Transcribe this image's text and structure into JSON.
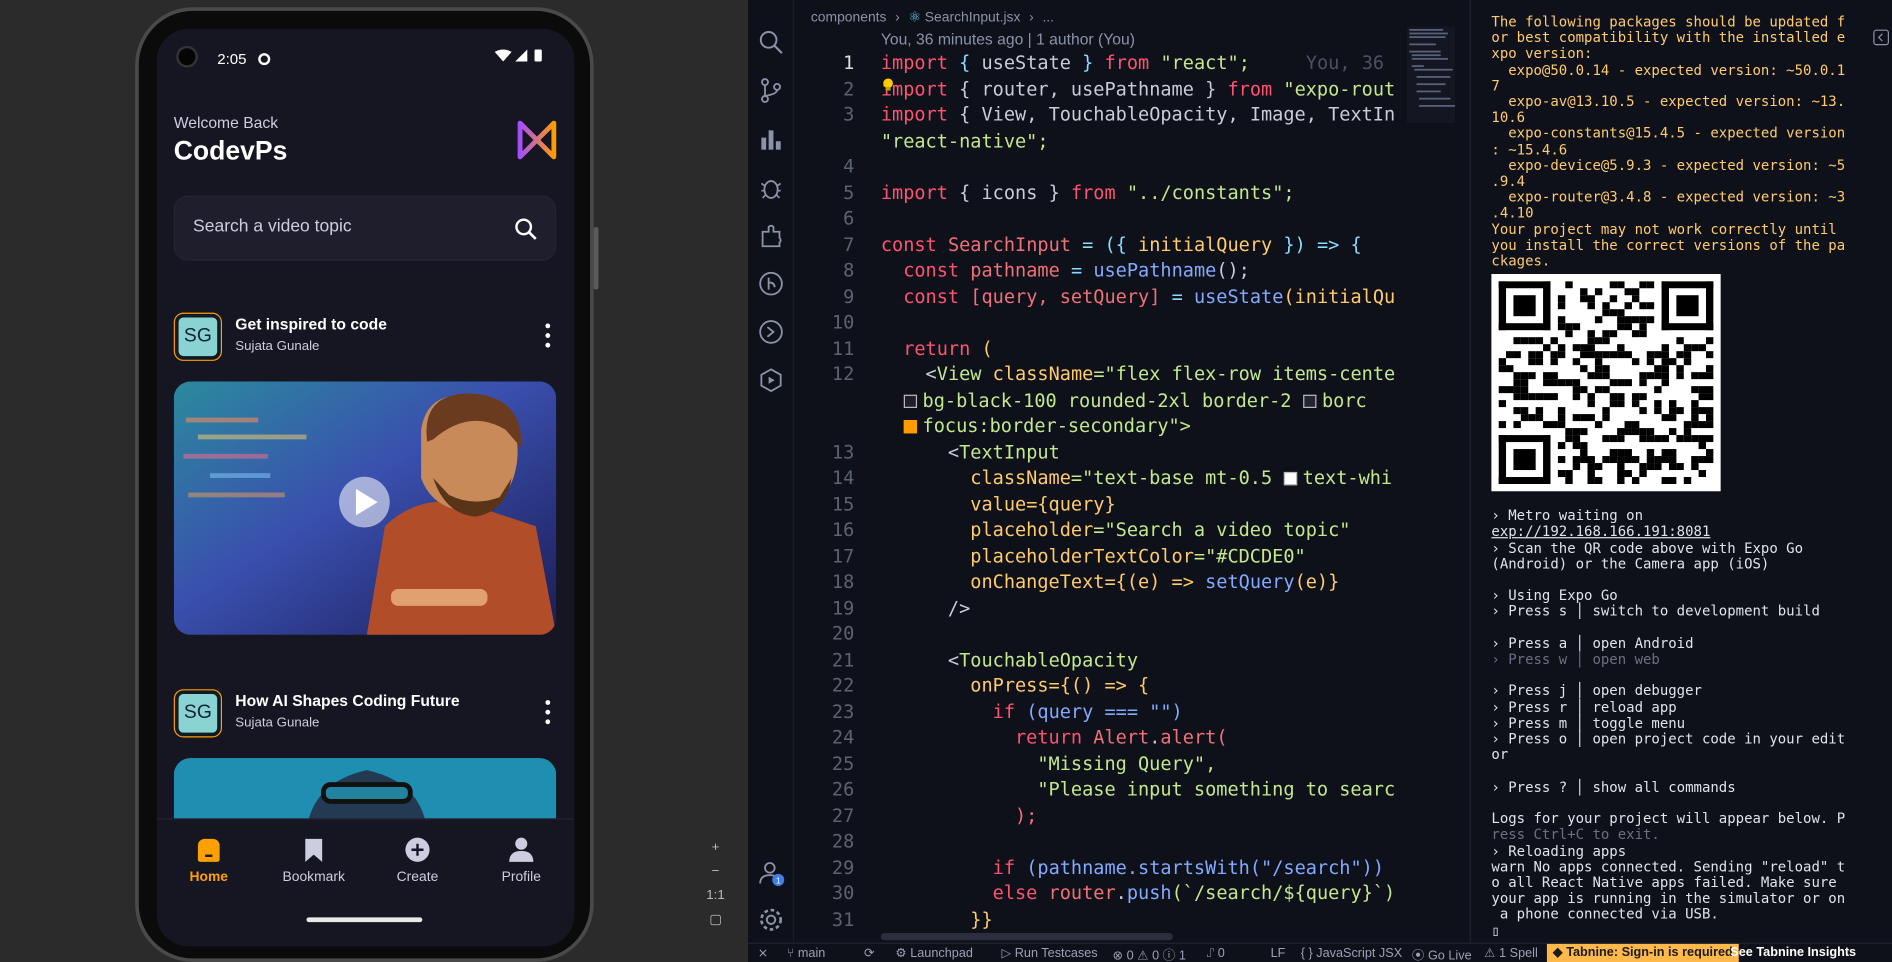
{
  "emulator": {
    "status_time": "2:05",
    "welcome_label": "Welcome Back",
    "username": "CodevPs",
    "search_placeholder": "Search a video topic",
    "posts": [
      {
        "title": "Get inspired to code",
        "author": "Sujata Gunale",
        "avatar": "SG"
      },
      {
        "title": "How AI Shapes Coding Future",
        "author": "Sujata Gunale",
        "avatar": "SG"
      }
    ],
    "tabs": [
      {
        "label": "Home",
        "icon": "home-icon",
        "active": true
      },
      {
        "label": "Bookmark",
        "icon": "bookmark-icon",
        "active": false
      },
      {
        "label": "Create",
        "icon": "plus-circle-icon",
        "active": false
      },
      {
        "label": "Profile",
        "icon": "profile-icon",
        "active": false
      }
    ],
    "tools": [
      "+",
      "−",
      "1:1",
      "▢"
    ],
    "accent": "#FF9C01"
  },
  "editor": {
    "breadcrumbs": [
      "components",
      "SearchInput.jsx",
      "..."
    ],
    "blame": "You, 36 minutes ago | 1 author (You)",
    "inline_blame": "You, 36",
    "accounts_badge": "1",
    "line_numbers": [
      "1",
      "2",
      "3",
      "",
      "4",
      "5",
      "6",
      "7",
      "8",
      "9",
      "10",
      "11",
      "12",
      "",
      "",
      "13",
      "14",
      "15",
      "16",
      "17",
      "18",
      "19",
      "20",
      "21",
      "22",
      "23",
      "24",
      "25",
      "26",
      "27",
      "28",
      "29",
      "30",
      "31"
    ],
    "code": {
      "l1_a": "import",
      "l1_b": " { ",
      "l1_c": "useState",
      "l1_d": " } ",
      "l1_e": "from",
      "l1_f": " \"react\";",
      "l2_a": "import",
      "l2_b": " { router, usePathname } ",
      "l2_c": "from",
      "l2_d": " \"expo-rout",
      "l3_a": "import",
      "l3_b": " { View, TouchableOpacity, Image, TextIn",
      "l3w": "\"react-native\";",
      "l5_a": "import",
      "l5_b": " { icons } ",
      "l5_c": "from",
      "l5_d": " \"../constants\";",
      "l7_a": "const ",
      "l7_b": "SearchInput",
      "l7_c": " = ({ ",
      "l7_d": "initialQuery",
      "l7_e": " }) => {",
      "l8_a": "  const ",
      "l8_b": "pathname",
      "l8_c": " = ",
      "l8_d": "usePathname",
      "l8_e": "();",
      "l9_a": "  const ",
      "l9_b": "[query, setQuery]",
      "l9_c": " = ",
      "l9_d": "useState",
      "l9_e": "(initialQu",
      "l11_a": "  return",
      "l11_b": " (",
      "l12_a": "    <",
      "l12_b": "View",
      "l12_c": " className",
      "l12_d": "=\"flex flex-row items-cente",
      "l12w1_a": "bg-black-100 rounded-2xl border-2 ",
      "l12w1_b": "borc",
      "l12w2": "focus:border-secondary\">",
      "l13_a": "      <",
      "l13_b": "TextInput",
      "l14_a": "        className",
      "l14_b": "=\"text-base mt-0.5 ",
      "l14_c": "text-whi",
      "l15_a": "        value",
      "l15_b": "={query}",
      "l16_a": "        placeholder",
      "l16_b": "=\"Search a video topic\"",
      "l17_a": "        placeholderTextColor",
      "l17_b": "=\"#CDCDE0\"",
      "l18_a": "        onChangeText",
      "l18_b": "={(e) => ",
      "l18_c": "setQuery",
      "l18_d": "(e)}",
      "l19": "      />",
      "l21_a": "      <",
      "l21_b": "TouchableOpacity",
      "l22_a": "        onPress",
      "l22_b": "={() => {",
      "l23_a": "          if",
      "l23_b": " (query === \"\")",
      "l24_a": "            return ",
      "l24_b": "Alert",
      "l24_c": ".",
      "l24_d": "alert",
      "l24_e": "(",
      "l25": "              \"Missing Query\",",
      "l26": "              \"Please input something to searc",
      "l27": "            );",
      "l29_a": "          if",
      "l29_b": " (pathname.",
      "l29_c": "startsWith",
      "l29_d": "(\"/search\"))",
      "l30_a": "          else ",
      "l30_b": "router",
      "l30_c": ".",
      "l30_d": "push",
      "l30_e": "(`/search/${query}`)",
      "l31": "        }}"
    }
  },
  "terminal": {
    "lines": [
      {
        "t": "The following packages should be updated f",
        "c": "ty"
      },
      {
        "t": "or best compatibility with the installed e",
        "c": "ty"
      },
      {
        "t": "xpo version:",
        "c": "ty"
      },
      {
        "t": "  expo@50.0.14 - expected version: ~50.0.1",
        "c": "ty"
      },
      {
        "t": "7",
        "c": "ty"
      },
      {
        "t": "  expo-av@13.10.5 - expected version: ~13.",
        "c": "ty"
      },
      {
        "t": "10.6",
        "c": "ty"
      },
      {
        "t": "  expo-constants@15.4.5 - expected version",
        "c": "ty"
      },
      {
        "t": ": ~15.4.6",
        "c": "ty"
      },
      {
        "t": "  expo-device@5.9.3 - expected version: ~5",
        "c": "ty"
      },
      {
        "t": ".9.4",
        "c": "ty"
      },
      {
        "t": "  expo-router@3.4.8 - expected version: ~3",
        "c": "ty"
      },
      {
        "t": ".4.10",
        "c": "ty"
      },
      {
        "t": "Your project may not work correctly until",
        "c": "ty"
      },
      {
        "t": "you install the correct versions of the pa",
        "c": "ty"
      },
      {
        "t": "ckages.",
        "c": "ty"
      }
    ],
    "after_qr": [
      {
        "t": "› Metro waiting on",
        "c": ""
      },
      {
        "t": "exp://192.168.166.191:8081",
        "c": "tu"
      },
      {
        "t": "› Scan the QR code above with Expo Go",
        "c": ""
      },
      {
        "t": "(Android) or the Camera app (iOS)",
        "c": ""
      },
      {
        "t": " ",
        "c": ""
      },
      {
        "t": "› Using Expo Go",
        "c": ""
      },
      {
        "t": "› Press s │ switch to development build",
        "c": ""
      },
      {
        "t": " ",
        "c": ""
      },
      {
        "t": "› Press a │ open Android",
        "c": ""
      },
      {
        "t": "› Press w │ open web",
        "c": "tm"
      },
      {
        "t": " ",
        "c": ""
      },
      {
        "t": "› Press j │ open debugger",
        "c": ""
      },
      {
        "t": "› Press r │ reload app",
        "c": ""
      },
      {
        "t": "› Press m │ toggle menu",
        "c": ""
      },
      {
        "t": "› Press o │ open project code in your edit",
        "c": ""
      },
      {
        "t": "or",
        "c": ""
      },
      {
        "t": " ",
        "c": ""
      },
      {
        "t": "› Press ? │ show all commands",
        "c": ""
      },
      {
        "t": " ",
        "c": ""
      },
      {
        "t": "Logs for your project will appear below. P",
        "c": ""
      },
      {
        "t": "ress Ctrl+C to exit.",
        "c": "tm"
      },
      {
        "t": "› Reloading apps",
        "c": ""
      },
      {
        "t": "warn No apps connected. Sending \"reload\" t",
        "c": ""
      },
      {
        "t": "o all React Native apps failed. Make sure",
        "c": ""
      },
      {
        "t": "your app is running in the simulator or on",
        "c": ""
      },
      {
        "t": " a phone connected via USB.",
        "c": ""
      },
      {
        "t": "▯",
        "c": ""
      }
    ]
  },
  "statusbar": {
    "branch": "main",
    "launchpad": "Launchpad",
    "run_tests": "Run Testcases",
    "problems": "⊗ 0 ⚠ 0 ⓘ 1",
    "ports": "⑀ 0",
    "eol": "LF",
    "language": "JavaScript JSX",
    "golive": "Go Live",
    "spell": "1 Spell",
    "tabnine": "Tabnine: Sign-in is required",
    "insights": "See Tabnine Insights"
  }
}
